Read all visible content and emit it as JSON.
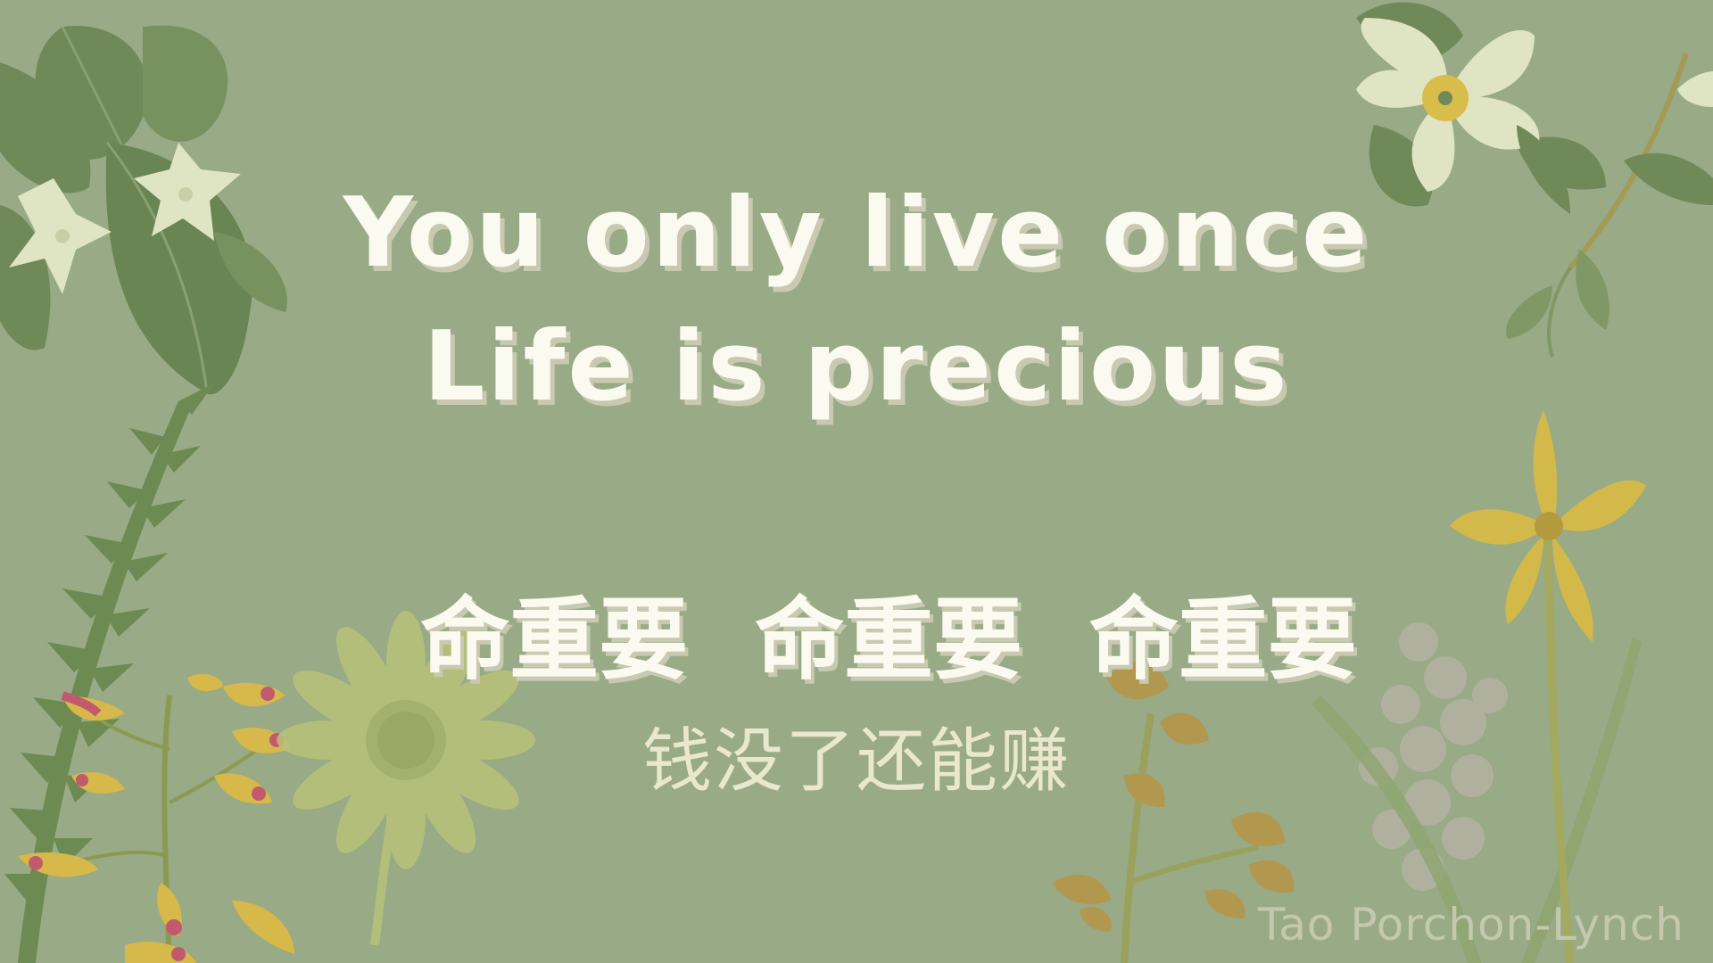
{
  "quote": {
    "line1": "You only live once",
    "line2": "Life is precious",
    "chinese_main": "命重要 命重要 命重要",
    "chinese_sub": "钱没了还能赚"
  },
  "credit": "Tao Porchon-Lynch",
  "colors": {
    "background": "#98aa86",
    "text": "#fbfaf1",
    "text_shadow": "#c8c9b0",
    "subtext": "#eae7cf",
    "leaf_dark": "#6f8a58",
    "leaf_mid": "#7f9866",
    "flower_cream": "#dfe4c2",
    "flower_yellow": "#d8bd4a",
    "flower_pink": "#c25a6e",
    "flower_ochre": "#b2974e"
  },
  "decorations": [
    "leaf-cluster-icon",
    "white-star-flower-icon",
    "fern-frond-icon",
    "pink-yellow-orchid-icon",
    "daisy-flower-icon",
    "dried-flower-stem-icon",
    "lupine-spike-icon",
    "yellow-lily-icon",
    "white-blossom-icon",
    "vine-branch-icon"
  ]
}
